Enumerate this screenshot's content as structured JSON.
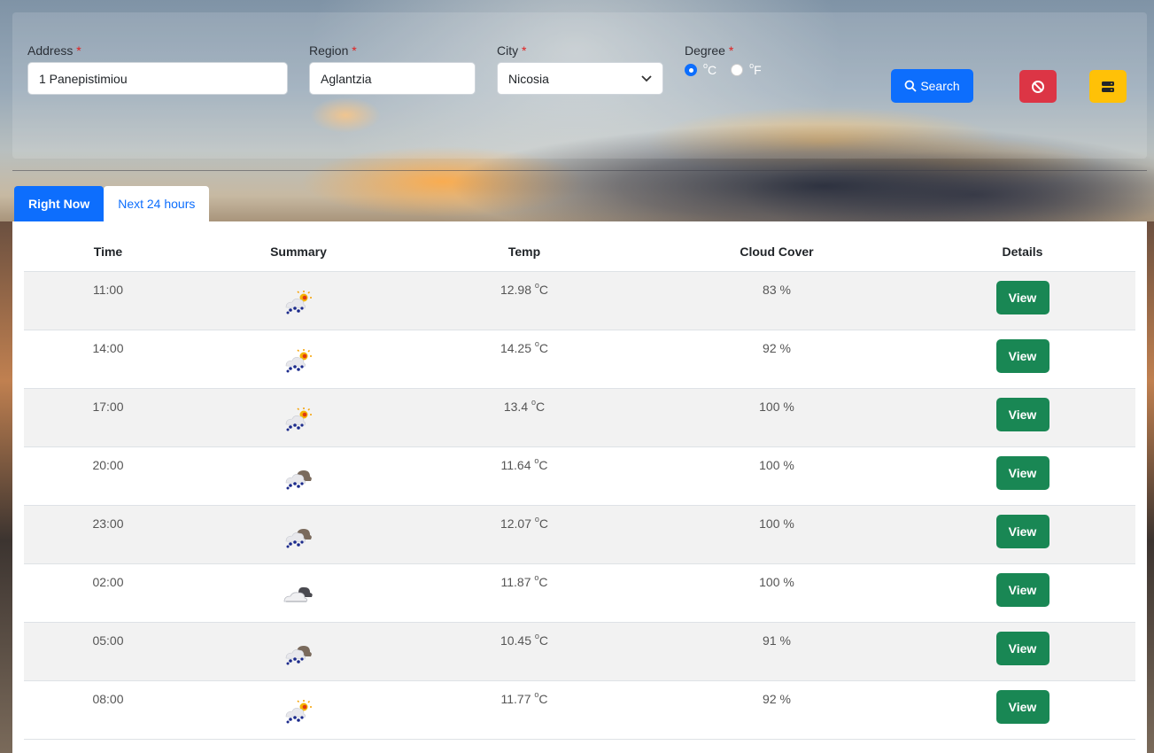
{
  "form": {
    "address_label": "Address",
    "address_value": "1 Panepistimiou",
    "region_label": "Region",
    "region_value": "Aglantzia",
    "city_label": "City",
    "city_value": "Nicosia",
    "degree_label": "Degree",
    "degree_celsius": "C",
    "degree_fahrenheit": "F",
    "degree_selected": "C",
    "required_marker": "*",
    "search_label": "Search"
  },
  "tabs": [
    {
      "label": "Right Now",
      "active": true
    },
    {
      "label": "Next 24 hours",
      "active": false
    }
  ],
  "table": {
    "headers": [
      "Time",
      "Summary",
      "Temp",
      "Cloud Cover",
      "Details"
    ],
    "rows": [
      {
        "time": "11:00",
        "icon": "rain-sun-icon",
        "temp": "12.98",
        "cloud": "83 %",
        "action": "View"
      },
      {
        "time": "14:00",
        "icon": "rain-sun-icon",
        "temp": "14.25",
        "cloud": "92 %",
        "action": "View"
      },
      {
        "time": "17:00",
        "icon": "rain-sun-icon",
        "temp": "13.4",
        "cloud": "100 %",
        "action": "View"
      },
      {
        "time": "20:00",
        "icon": "rain-cloud-icon",
        "temp": "11.64",
        "cloud": "100 %",
        "action": "View"
      },
      {
        "time": "23:00",
        "icon": "rain-cloud-icon",
        "temp": "12.07",
        "cloud": "100 %",
        "action": "View"
      },
      {
        "time": "02:00",
        "icon": "cloudy-icon",
        "temp": "11.87",
        "cloud": "100 %",
        "action": "View"
      },
      {
        "time": "05:00",
        "icon": "rain-cloud-icon",
        "temp": "10.45",
        "cloud": "91 %",
        "action": "View"
      },
      {
        "time": "08:00",
        "icon": "rain-sun-icon",
        "temp": "11.77",
        "cloud": "92 %",
        "action": "View"
      }
    ],
    "temp_unit": "C",
    "degree_symbol": "o"
  },
  "colors": {
    "primary": "#0d6efd",
    "danger": "#dc3545",
    "warning": "#ffc107",
    "success": "#198754",
    "required": "#e02020"
  }
}
